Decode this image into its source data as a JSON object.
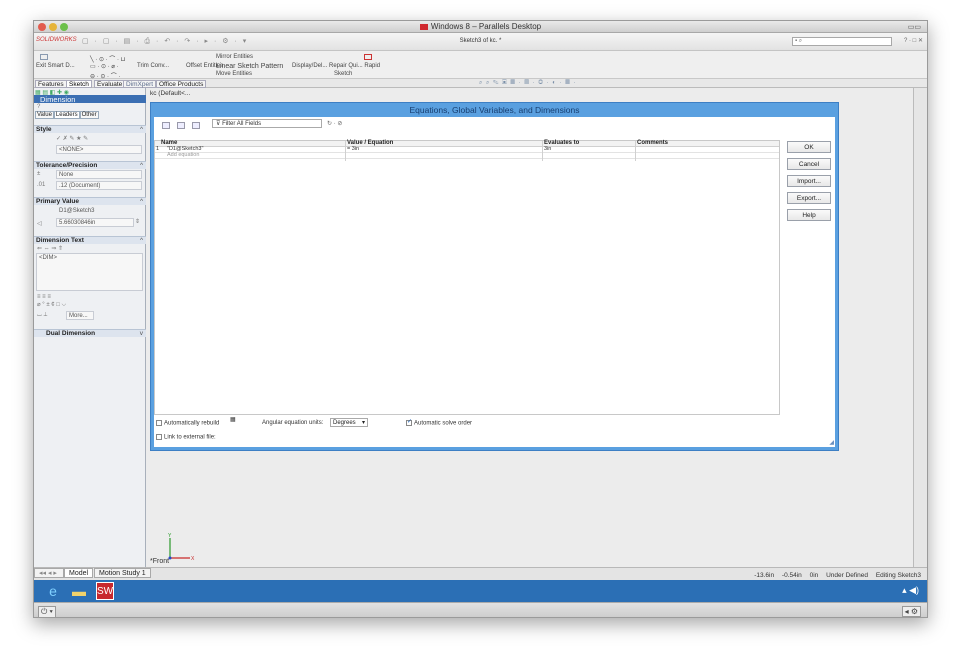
{
  "mac": {
    "title": "Windows 8 – Parallels Desktop"
  },
  "solidworks": {
    "logo": "SOLIDWORKS",
    "document_title": "Sketch3 of kc. *",
    "search_placeholder": "",
    "help": "? · □ ✕"
  },
  "command_manager": {
    "items": [
      {
        "label": "Exit Smart D... ",
        "name": "exit-sketch"
      },
      {
        "label": "Trim Conv...",
        "name": "trim-entities"
      },
      {
        "label": "Offset Entities",
        "name": "offset-entities"
      },
      {
        "label": "Mirror Entities",
        "name": "mirror-entities"
      },
      {
        "label": "Linear Sketch Pattern",
        "name": "linear-sketch-pattern"
      },
      {
        "label": "Move Entities",
        "name": "move-entities"
      },
      {
        "label": "Display/Del... Repair Qui... Rapid",
        "name": "display-delete"
      },
      {
        "label": "Sketch",
        "name": "sketch-label"
      }
    ]
  },
  "tabs": [
    {
      "label": "Features",
      "active": false
    },
    {
      "label": "Sketch",
      "active": true
    },
    {
      "label": "Evaluate",
      "active": false
    },
    {
      "label": "DimXpert",
      "active": false
    },
    {
      "label": "Office Products",
      "active": false
    }
  ],
  "property_manager": {
    "title": "Dimension",
    "tabs": [
      {
        "label": "Value",
        "selected": false
      },
      {
        "label": "Leaders",
        "selected": true
      },
      {
        "label": "Other",
        "selected": false
      }
    ],
    "groups": {
      "style": "Style",
      "tolerance": "Tolerance/Precision",
      "primary_value": "Primary Value",
      "dimension_text": "Dimension Text",
      "dual_dimension": "Dual Dimension"
    },
    "style_value": "<NONE>",
    "tolerance_type": "None",
    "precision": ".12 (Document)",
    "primary_name": "D1@Sketch3",
    "primary_value": "5.66030846in",
    "dimension_text": "<DIM>",
    "more_button": "More..."
  },
  "graphics": {
    "tree_label": "kc (Default<...",
    "view_label": "*Front"
  },
  "dialog": {
    "title": "Equations, Global Variables, and Dimensions",
    "filter": "Filter All Fields",
    "columns": {
      "name": "Name",
      "value": "Value / Equation",
      "evaluates": "Evaluates to",
      "comments": "Comments"
    },
    "rows": [
      {
        "name": "\"D1@Sketch3\"",
        "value": "= 3in",
        "evaluates": "3in",
        "comments": ""
      },
      {
        "name": "Add equation",
        "value": "",
        "evaluates": "",
        "comments": ""
      }
    ],
    "buttons": {
      "ok": "OK",
      "cancel": "Cancel",
      "import": "Import...",
      "export": "Export...",
      "help": "Help"
    },
    "auto_rebuild": "Automatically rebuild",
    "angular_units_label": "Angular equation units:",
    "angular_units_value": "Degrees",
    "auto_solve": "Automatic solve order",
    "link_file": "Link to external file:"
  },
  "status": {
    "model_tab": "Model",
    "motion_tab": "Motion Study 1",
    "x": "-13.6in",
    "y": "-0.54in",
    "z": "0in",
    "state": "Under Defined",
    "editing": "Editing Sketch3"
  },
  "colors": {
    "dialog_frame": "#5aa0e0",
    "taskbar": "#2b6fb5",
    "pm_title": "#3b6fb3"
  }
}
